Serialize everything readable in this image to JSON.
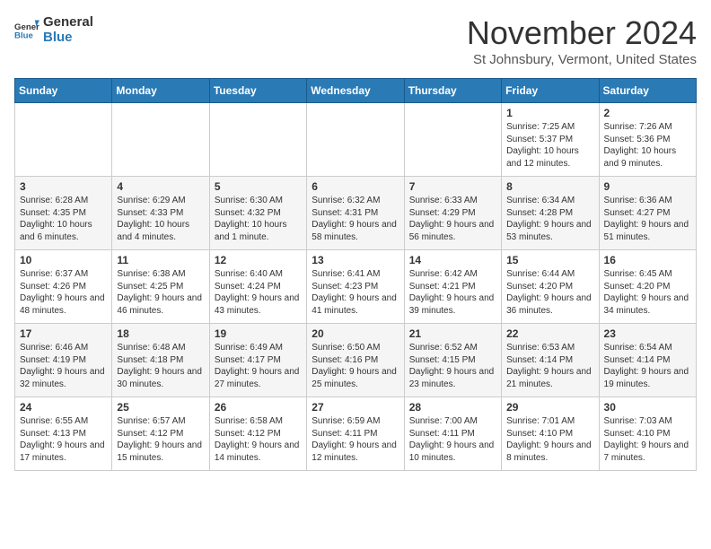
{
  "header": {
    "logo_general": "General",
    "logo_blue": "Blue",
    "month_title": "November 2024",
    "location": "St Johnsbury, Vermont, United States"
  },
  "weekdays": [
    "Sunday",
    "Monday",
    "Tuesday",
    "Wednesday",
    "Thursday",
    "Friday",
    "Saturday"
  ],
  "weeks": [
    [
      {
        "day": "",
        "info": ""
      },
      {
        "day": "",
        "info": ""
      },
      {
        "day": "",
        "info": ""
      },
      {
        "day": "",
        "info": ""
      },
      {
        "day": "",
        "info": ""
      },
      {
        "day": "1",
        "info": "Sunrise: 7:25 AM\nSunset: 5:37 PM\nDaylight: 10 hours and 12 minutes."
      },
      {
        "day": "2",
        "info": "Sunrise: 7:26 AM\nSunset: 5:36 PM\nDaylight: 10 hours and 9 minutes."
      }
    ],
    [
      {
        "day": "3",
        "info": "Sunrise: 6:28 AM\nSunset: 4:35 PM\nDaylight: 10 hours and 6 minutes."
      },
      {
        "day": "4",
        "info": "Sunrise: 6:29 AM\nSunset: 4:33 PM\nDaylight: 10 hours and 4 minutes."
      },
      {
        "day": "5",
        "info": "Sunrise: 6:30 AM\nSunset: 4:32 PM\nDaylight: 10 hours and 1 minute."
      },
      {
        "day": "6",
        "info": "Sunrise: 6:32 AM\nSunset: 4:31 PM\nDaylight: 9 hours and 58 minutes."
      },
      {
        "day": "7",
        "info": "Sunrise: 6:33 AM\nSunset: 4:29 PM\nDaylight: 9 hours and 56 minutes."
      },
      {
        "day": "8",
        "info": "Sunrise: 6:34 AM\nSunset: 4:28 PM\nDaylight: 9 hours and 53 minutes."
      },
      {
        "day": "9",
        "info": "Sunrise: 6:36 AM\nSunset: 4:27 PM\nDaylight: 9 hours and 51 minutes."
      }
    ],
    [
      {
        "day": "10",
        "info": "Sunrise: 6:37 AM\nSunset: 4:26 PM\nDaylight: 9 hours and 48 minutes."
      },
      {
        "day": "11",
        "info": "Sunrise: 6:38 AM\nSunset: 4:25 PM\nDaylight: 9 hours and 46 minutes."
      },
      {
        "day": "12",
        "info": "Sunrise: 6:40 AM\nSunset: 4:24 PM\nDaylight: 9 hours and 43 minutes."
      },
      {
        "day": "13",
        "info": "Sunrise: 6:41 AM\nSunset: 4:23 PM\nDaylight: 9 hours and 41 minutes."
      },
      {
        "day": "14",
        "info": "Sunrise: 6:42 AM\nSunset: 4:21 PM\nDaylight: 9 hours and 39 minutes."
      },
      {
        "day": "15",
        "info": "Sunrise: 6:44 AM\nSunset: 4:20 PM\nDaylight: 9 hours and 36 minutes."
      },
      {
        "day": "16",
        "info": "Sunrise: 6:45 AM\nSunset: 4:20 PM\nDaylight: 9 hours and 34 minutes."
      }
    ],
    [
      {
        "day": "17",
        "info": "Sunrise: 6:46 AM\nSunset: 4:19 PM\nDaylight: 9 hours and 32 minutes."
      },
      {
        "day": "18",
        "info": "Sunrise: 6:48 AM\nSunset: 4:18 PM\nDaylight: 9 hours and 30 minutes."
      },
      {
        "day": "19",
        "info": "Sunrise: 6:49 AM\nSunset: 4:17 PM\nDaylight: 9 hours and 27 minutes."
      },
      {
        "day": "20",
        "info": "Sunrise: 6:50 AM\nSunset: 4:16 PM\nDaylight: 9 hours and 25 minutes."
      },
      {
        "day": "21",
        "info": "Sunrise: 6:52 AM\nSunset: 4:15 PM\nDaylight: 9 hours and 23 minutes."
      },
      {
        "day": "22",
        "info": "Sunrise: 6:53 AM\nSunset: 4:14 PM\nDaylight: 9 hours and 21 minutes."
      },
      {
        "day": "23",
        "info": "Sunrise: 6:54 AM\nSunset: 4:14 PM\nDaylight: 9 hours and 19 minutes."
      }
    ],
    [
      {
        "day": "24",
        "info": "Sunrise: 6:55 AM\nSunset: 4:13 PM\nDaylight: 9 hours and 17 minutes."
      },
      {
        "day": "25",
        "info": "Sunrise: 6:57 AM\nSunset: 4:12 PM\nDaylight: 9 hours and 15 minutes."
      },
      {
        "day": "26",
        "info": "Sunrise: 6:58 AM\nSunset: 4:12 PM\nDaylight: 9 hours and 14 minutes."
      },
      {
        "day": "27",
        "info": "Sunrise: 6:59 AM\nSunset: 4:11 PM\nDaylight: 9 hours and 12 minutes."
      },
      {
        "day": "28",
        "info": "Sunrise: 7:00 AM\nSunset: 4:11 PM\nDaylight: 9 hours and 10 minutes."
      },
      {
        "day": "29",
        "info": "Sunrise: 7:01 AM\nSunset: 4:10 PM\nDaylight: 9 hours and 8 minutes."
      },
      {
        "day": "30",
        "info": "Sunrise: 7:03 AM\nSunset: 4:10 PM\nDaylight: 9 hours and 7 minutes."
      }
    ]
  ]
}
